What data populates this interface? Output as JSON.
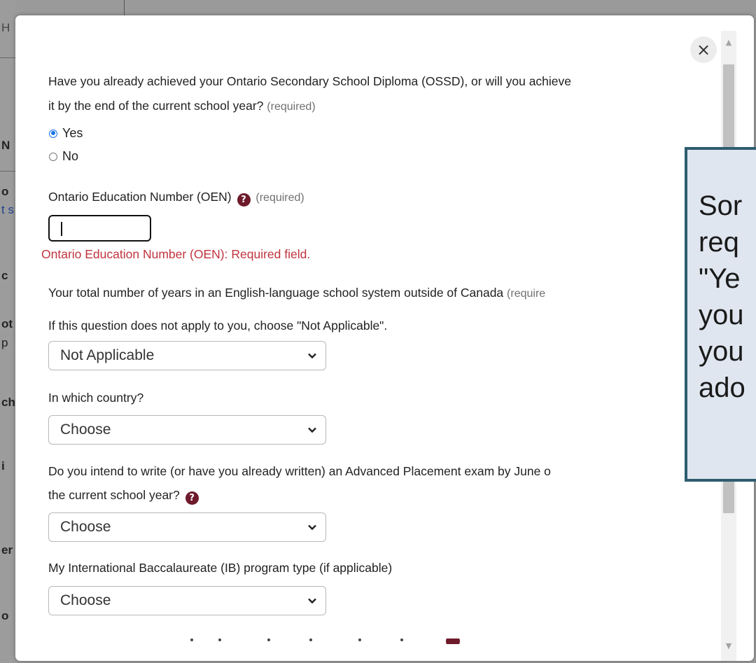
{
  "background": {
    "fragments": [
      "H",
      "N",
      "o",
      "t s",
      "c",
      "ot",
      "p",
      "ch",
      "i",
      "er",
      "o"
    ]
  },
  "modal": {
    "close_glyph": "×",
    "q1": {
      "text": "Have you already achieved your Ontario Secondary School Diploma (OSSD), or will you achieve",
      "text2": "it by the end of the current school year?",
      "required": "(required)",
      "options": [
        "Yes",
        "No"
      ],
      "selected": "Yes"
    },
    "oen": {
      "label": "Ontario Education Number (OEN)",
      "required": "(required)",
      "value": "",
      "error": "Ontario Education Number (OEN): Required field."
    },
    "years": {
      "label": "Your total number of years in an English-language school system outside of Canada",
      "required": "(require",
      "hint": "If this question does not apply to you, choose \"Not Applicable\".",
      "value": "Not Applicable"
    },
    "country": {
      "label": "In which country?",
      "value": "Choose"
    },
    "ap": {
      "label": "Do you intend to write (or have you already written) an Advanced Placement exam by June o",
      "label2": "the current school year?",
      "value": "Choose"
    },
    "ib": {
      "label": "My International Baccalaureate (IB) program type (if applicable)",
      "value": "Choose"
    }
  },
  "tooltip": {
    "lines": [
      "Sor",
      "req",
      "\"Ye",
      "you",
      "you",
      "ado"
    ]
  },
  "colors": {
    "accent": "#1a73e8",
    "error": "#c0343e",
    "help_icon": "#6e1a2b",
    "tooltip_border": "#2e5c6e",
    "tooltip_bg": "#dfe6ef"
  }
}
